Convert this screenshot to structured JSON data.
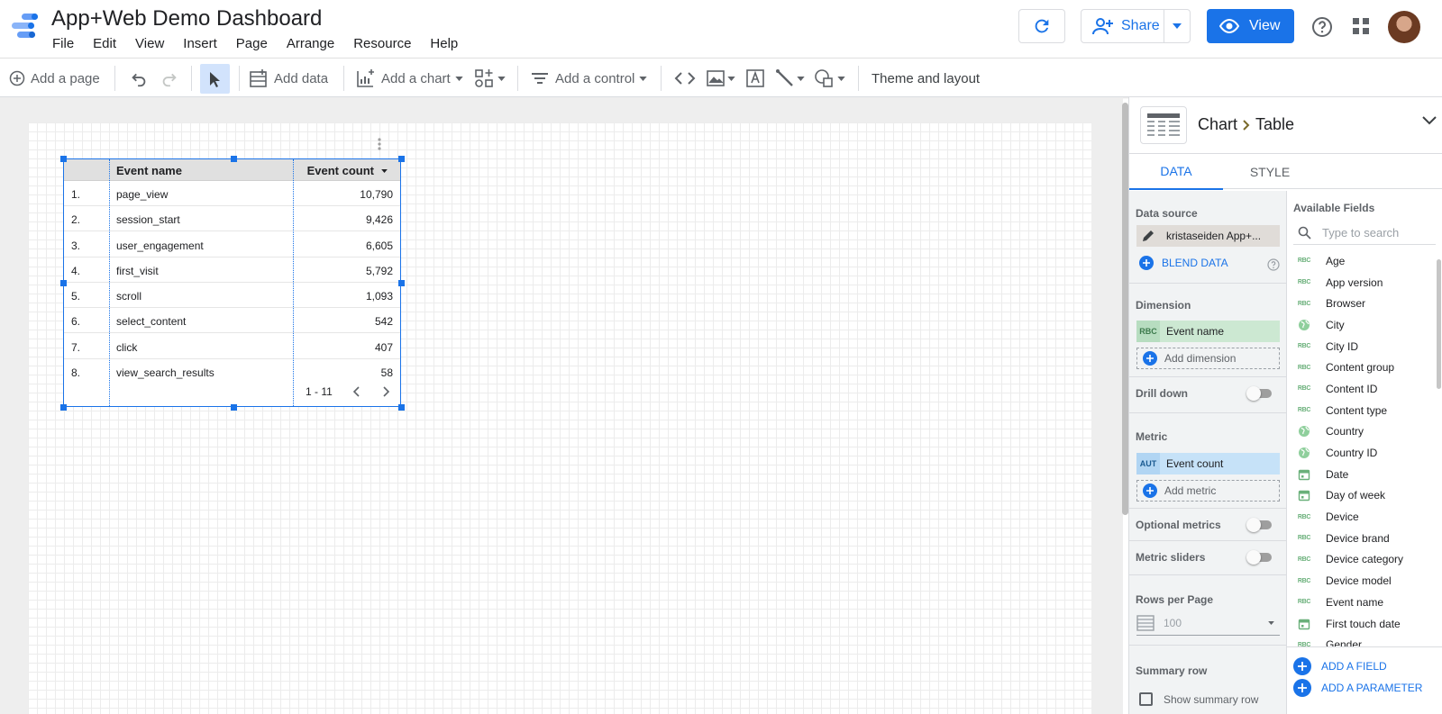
{
  "app": {
    "title": "App+Web Demo Dashboard",
    "menu": [
      "File",
      "Edit",
      "View",
      "Insert",
      "Page",
      "Arrange",
      "Resource",
      "Help"
    ],
    "share_label": "Share",
    "view_label": "View",
    "brand_color": "#1a73e8"
  },
  "toolbar": {
    "add_page": "Add a page",
    "add_data": "Add data",
    "add_chart": "Add a chart",
    "add_control": "Add a control",
    "theme_layout": "Theme and layout"
  },
  "table": {
    "columns": [
      "Event name",
      "Event count"
    ],
    "rows": [
      {
        "num": "1.",
        "name": "page_view",
        "value": "10,790"
      },
      {
        "num": "2.",
        "name": "session_start",
        "value": "9,426"
      },
      {
        "num": "3.",
        "name": "user_engagement",
        "value": "6,605"
      },
      {
        "num": "4.",
        "name": "first_visit",
        "value": "5,792"
      },
      {
        "num": "5.",
        "name": "scroll",
        "value": "1,093"
      },
      {
        "num": "6.",
        "name": "select_content",
        "value": "542"
      },
      {
        "num": "7.",
        "name": "click",
        "value": "407"
      },
      {
        "num": "8.",
        "name": "view_search_results",
        "value": "58"
      }
    ],
    "pagination": "1 - 11"
  },
  "panel": {
    "breadcrumb_chart": "Chart",
    "breadcrumb_table": "Table",
    "tabs": [
      "DATA",
      "STYLE"
    ],
    "data_source_label": "Data source",
    "data_source_value": "kristaseiden App+...",
    "blend_data": "BLEND DATA",
    "dimension_label": "Dimension",
    "dimension_value": "Event name",
    "dimension_badge": "RBC",
    "add_dimension": "Add dimension",
    "drill_down": "Drill down",
    "metric_label": "Metric",
    "metric_value": "Event count",
    "metric_badge": "AUT",
    "add_metric": "Add metric",
    "optional_metrics": "Optional metrics",
    "metric_sliders": "Metric sliders",
    "rows_per_page_label": "Rows per Page",
    "rows_per_page_value": "100",
    "summary_row_label": "Summary row",
    "show_summary_row": "Show summary row",
    "available_fields_title": "Available Fields",
    "search_placeholder": "Type to search",
    "fields": [
      {
        "name": "Age",
        "icon": "text-field-icon"
      },
      {
        "name": "App version",
        "icon": "text-field-icon"
      },
      {
        "name": "Browser",
        "icon": "text-field-icon"
      },
      {
        "name": "City",
        "icon": "geo-field-icon"
      },
      {
        "name": "City ID",
        "icon": "text-field-icon"
      },
      {
        "name": "Content group",
        "icon": "text-field-icon"
      },
      {
        "name": "Content ID",
        "icon": "text-field-icon"
      },
      {
        "name": "Content type",
        "icon": "text-field-icon"
      },
      {
        "name": "Country",
        "icon": "geo-field-icon"
      },
      {
        "name": "Country ID",
        "icon": "geo-field-icon"
      },
      {
        "name": "Date",
        "icon": "date-field-icon"
      },
      {
        "name": "Day of week",
        "icon": "date-field-icon"
      },
      {
        "name": "Device",
        "icon": "text-field-icon"
      },
      {
        "name": "Device brand",
        "icon": "text-field-icon"
      },
      {
        "name": "Device category",
        "icon": "text-field-icon"
      },
      {
        "name": "Device model",
        "icon": "text-field-icon"
      },
      {
        "name": "Event name",
        "icon": "text-field-icon"
      },
      {
        "name": "First touch date",
        "icon": "date-field-icon"
      },
      {
        "name": "Gender",
        "icon": "text-field-icon"
      }
    ],
    "add_field": "ADD A FIELD",
    "add_parameter": "ADD A PARAMETER"
  }
}
